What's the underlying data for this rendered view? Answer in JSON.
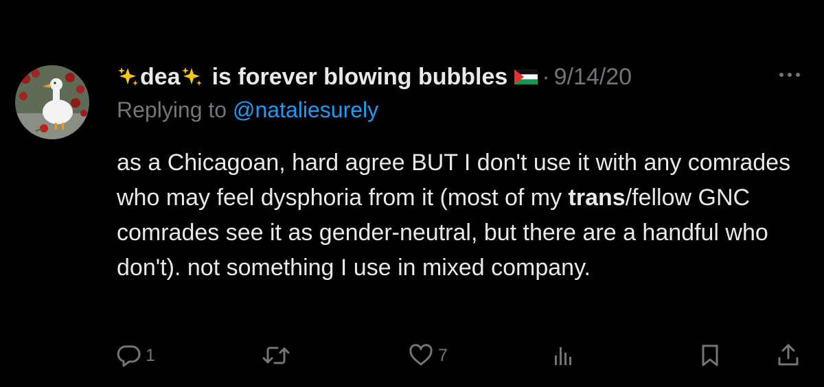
{
  "tweet": {
    "display_name_part1": "dea",
    "display_name_part2": "is forever blowing bubbles",
    "separator": "·",
    "date": "9/14/20",
    "reply_prefix": "Replying to ",
    "reply_handle": "@nataliesurely",
    "body_part1": "as a Chicagoan, hard agree BUT I don't use it with any comrades who may feel dysphoria from it (most of my ",
    "body_bold": "trans",
    "body_part2": "/fellow GNC comrades see it as gender-neutral, but there are a handful who don't). not something I use in mixed company."
  },
  "actions": {
    "reply_count": "1",
    "like_count": "7"
  },
  "icons": {
    "reply": "speech-bubble-icon",
    "retweet": "retweet-icon",
    "like": "heart-icon",
    "views": "bar-chart-icon",
    "bookmark": "bookmark-icon",
    "share": "share-icon",
    "more": "more-icon",
    "sparkles": "sparkles-icon",
    "flag": "palestine-flag-icon"
  },
  "colors": {
    "background": "#000000",
    "text": "#e7e9ea",
    "muted": "#71767b",
    "link": "#1d9bf0"
  }
}
